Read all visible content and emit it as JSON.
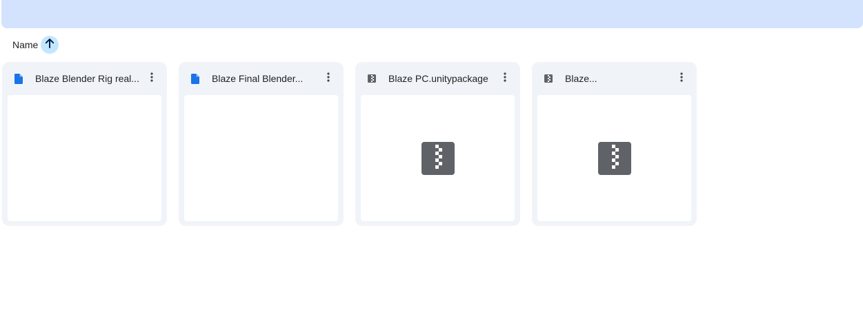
{
  "sort": {
    "label": "Name",
    "direction_icon": "arrow-upward-icon"
  },
  "colors": {
    "banner": "#d3e3fd",
    "sort_button": "#c2e7ff",
    "card_bg": "#f0f4f9",
    "doc_icon": "#1a73e8",
    "zip_icon": "#5f6368"
  },
  "files": [
    {
      "name": "Blaze Blender Rig real...",
      "icon": "doc-icon",
      "preview": "blank"
    },
    {
      "name": "Blaze Final Blender...",
      "icon": "doc-icon",
      "preview": "blank"
    },
    {
      "name": "Blaze PC.unitypackage",
      "icon": "zip-icon",
      "preview": "zip"
    },
    {
      "name": "Blaze...",
      "icon": "zip-icon",
      "preview": "zip"
    }
  ]
}
